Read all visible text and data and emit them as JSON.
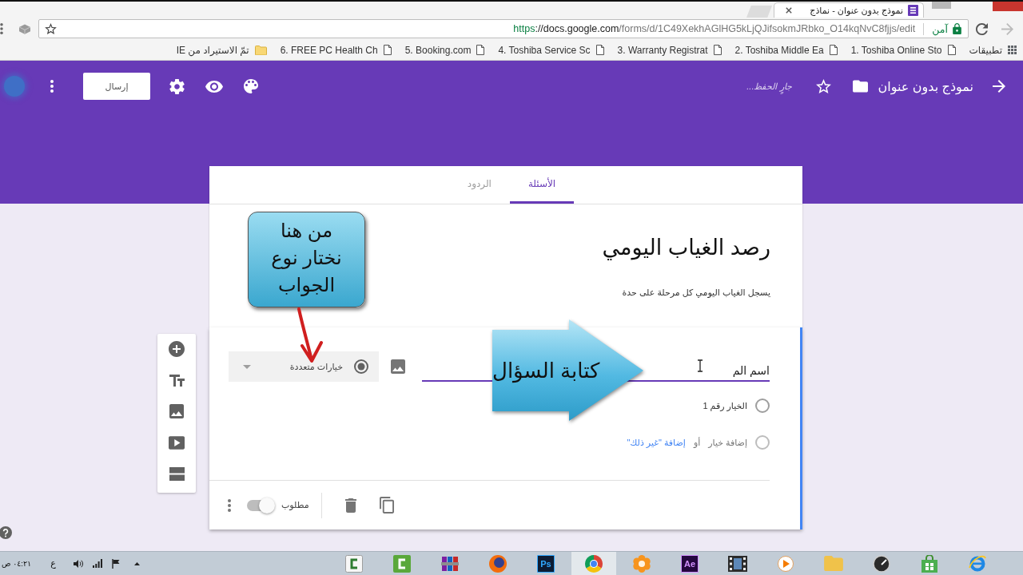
{
  "browser": {
    "tab": {
      "title": "نموذج بدون عنوان - نماذج"
    },
    "address_bar": {
      "scheme": "https",
      "host": "://docs.google.com",
      "path": "/forms/d/1C49XekhAGlHG5kLjQJifsokmJRbko_O14kqNvC8fjjs/edit",
      "security": "آمن"
    },
    "bookmarks": [
      {
        "kind": "apps",
        "label": "تطبيقات"
      },
      {
        "kind": "page",
        "label": "1. Toshiba Online Sto"
      },
      {
        "kind": "page",
        "label": "2. Toshiba Middle Ea"
      },
      {
        "kind": "page",
        "label": "3. Warranty Registrat"
      },
      {
        "kind": "page",
        "label": "4. Toshiba Service Sc"
      },
      {
        "kind": "page",
        "label": "5. Booking.com"
      },
      {
        "kind": "page",
        "label": "6. FREE PC Health Ch"
      },
      {
        "kind": "folder",
        "label": "تمّ الاستيراد من IE"
      }
    ]
  },
  "header": {
    "title": "نموذج بدون عنوان",
    "save_status": "جارٍ الحفظ...",
    "send_button": "إرسال"
  },
  "tabs": [
    {
      "label": "الأسئلة",
      "selected": true
    },
    {
      "label": "الردود",
      "selected": false
    }
  ],
  "form": {
    "title": "رصد الغياب اليومي",
    "description": "يسجل الغياب اليومي كل مرحلة على حدة"
  },
  "question": {
    "text": "اسم الم",
    "type": "خيارات متعددة",
    "options": [
      {
        "label": "الخيار رقم 1"
      }
    ],
    "add_option": "إضافة خيار",
    "or": "أو",
    "add_other": "إضافة \"غير ذلك\"",
    "required_label": "مطلوب",
    "required": false
  },
  "annotations": [
    {
      "kind": "callout",
      "text": "من هنا\nنختار نوع\nالجواب"
    },
    {
      "kind": "arrow",
      "text": "كتابة السؤال"
    }
  ],
  "taskbar": {
    "clock": "٠٤:٢١ ص",
    "language": "ع",
    "apps": [
      {
        "kind": "e-ring",
        "active": false
      },
      {
        "kind": "bag",
        "active": false
      },
      {
        "kind": "gauge",
        "active": false
      },
      {
        "kind": "folder",
        "active": false
      },
      {
        "kind": "play",
        "active": false
      },
      {
        "kind": "film",
        "active": false
      },
      {
        "kind": "letters-violet",
        "label": "Ae",
        "active": false
      },
      {
        "kind": "flower",
        "active": false
      },
      {
        "kind": "chrome",
        "active": true
      },
      {
        "kind": "letters-navy",
        "label": "Ps",
        "active": false
      },
      {
        "kind": "orange-globe",
        "active": false
      },
      {
        "kind": "books",
        "active": false
      },
      {
        "kind": "tile-c-green",
        "active": false
      },
      {
        "kind": "tile-c-light",
        "active": false
      }
    ]
  }
}
